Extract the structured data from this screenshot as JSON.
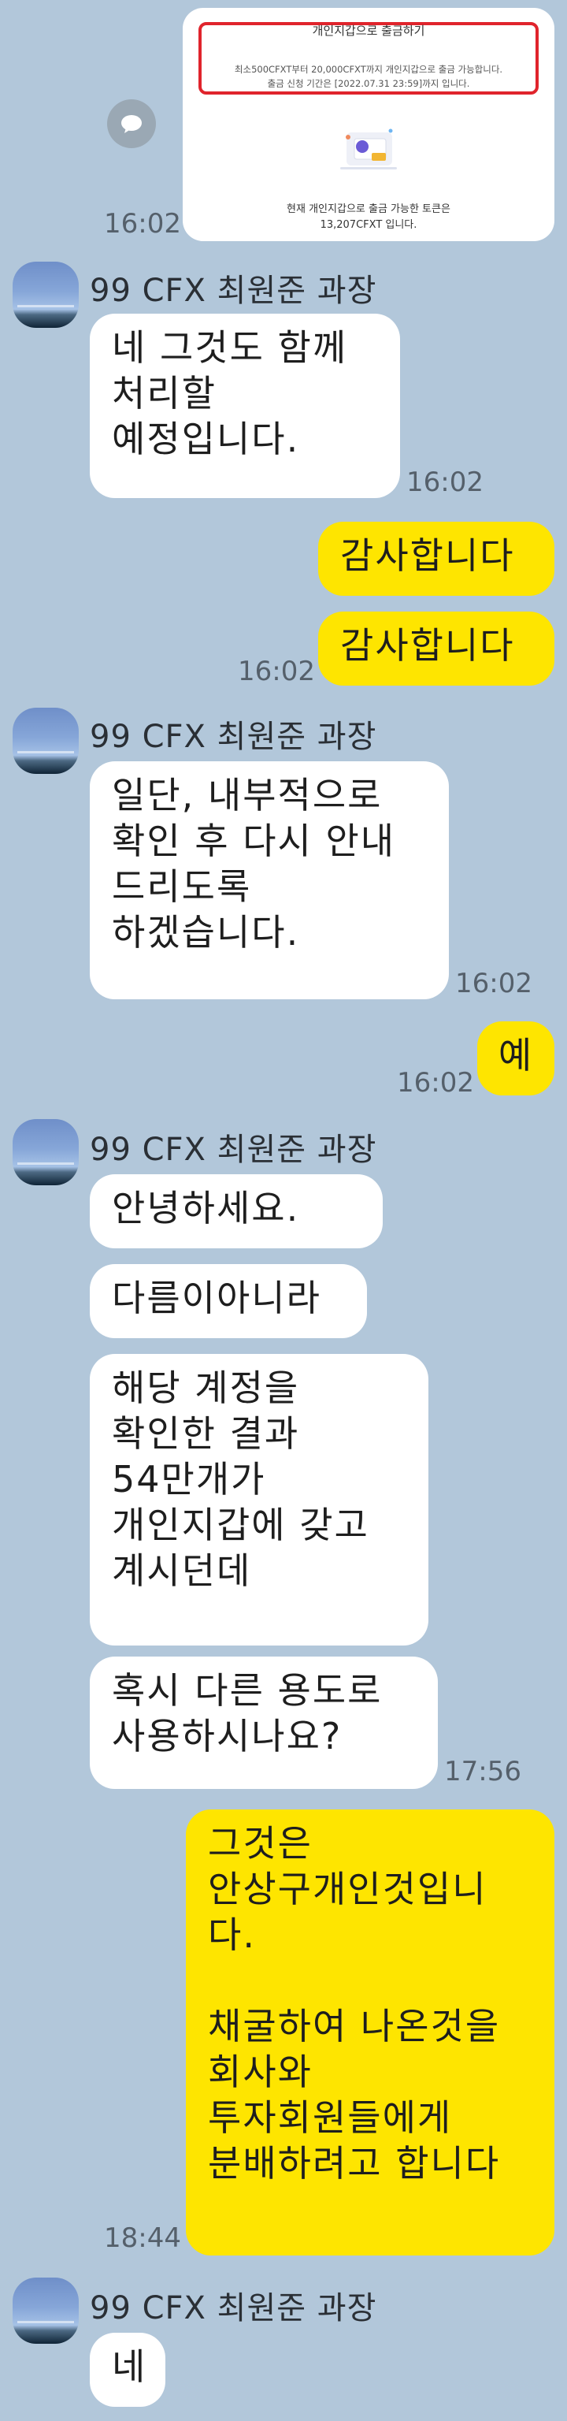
{
  "card": {
    "title": "개인지갑으로 출금하기",
    "line1": "최소500CFXT부터 20,000CFXT까지 개인지갑으로 출금 가능합니다.",
    "line2": "출금 신청 기간은 [2022.07.31 23:59]까지 입니다.",
    "foot1": "현재 개인지갑으로 출금 가능한 토큰은",
    "foot2": "13,207CFXT 입니다.",
    "time": "16:02"
  },
  "sender_name": "99 CFX 최원준 과장",
  "messages": [
    {
      "id": "m1",
      "from": "them",
      "text": "네 그것도 함께\n처리할\n예정입니다.",
      "time": "16:02"
    },
    {
      "id": "m2",
      "from": "me",
      "text": "감사합니다"
    },
    {
      "id": "m3",
      "from": "me",
      "text": "감사합니다",
      "time": "16:02"
    },
    {
      "id": "m4",
      "from": "them",
      "text": "일단, 내부적으로\n확인 후 다시 안내\n드리도록\n하겠습니다.",
      "time": "16:02"
    },
    {
      "id": "m5",
      "from": "me",
      "text": "예",
      "time": "16:02"
    },
    {
      "id": "m6",
      "from": "them",
      "text": "안녕하세요."
    },
    {
      "id": "m7",
      "from": "them",
      "text": "다름이아니라"
    },
    {
      "id": "m8",
      "from": "them",
      "text": "해당 계정을\n확인한 결과\n54만개가\n개인지갑에 갖고\n계시던데"
    },
    {
      "id": "m9",
      "from": "them",
      "text": "혹시 다른 용도로\n사용하시나요?",
      "time": "17:56"
    },
    {
      "id": "m10",
      "from": "me",
      "text": "그것은\n안상구개인것입니\n다.\n\n채굴하여 나온것을\n회사와\n투자회원들에게\n분배하려고 합니다",
      "time": "18:44"
    },
    {
      "id": "m11",
      "from": "them",
      "text": "네"
    }
  ],
  "colors": {
    "background": "#b2c7da",
    "me": "#fee500",
    "them": "#ffffff"
  }
}
